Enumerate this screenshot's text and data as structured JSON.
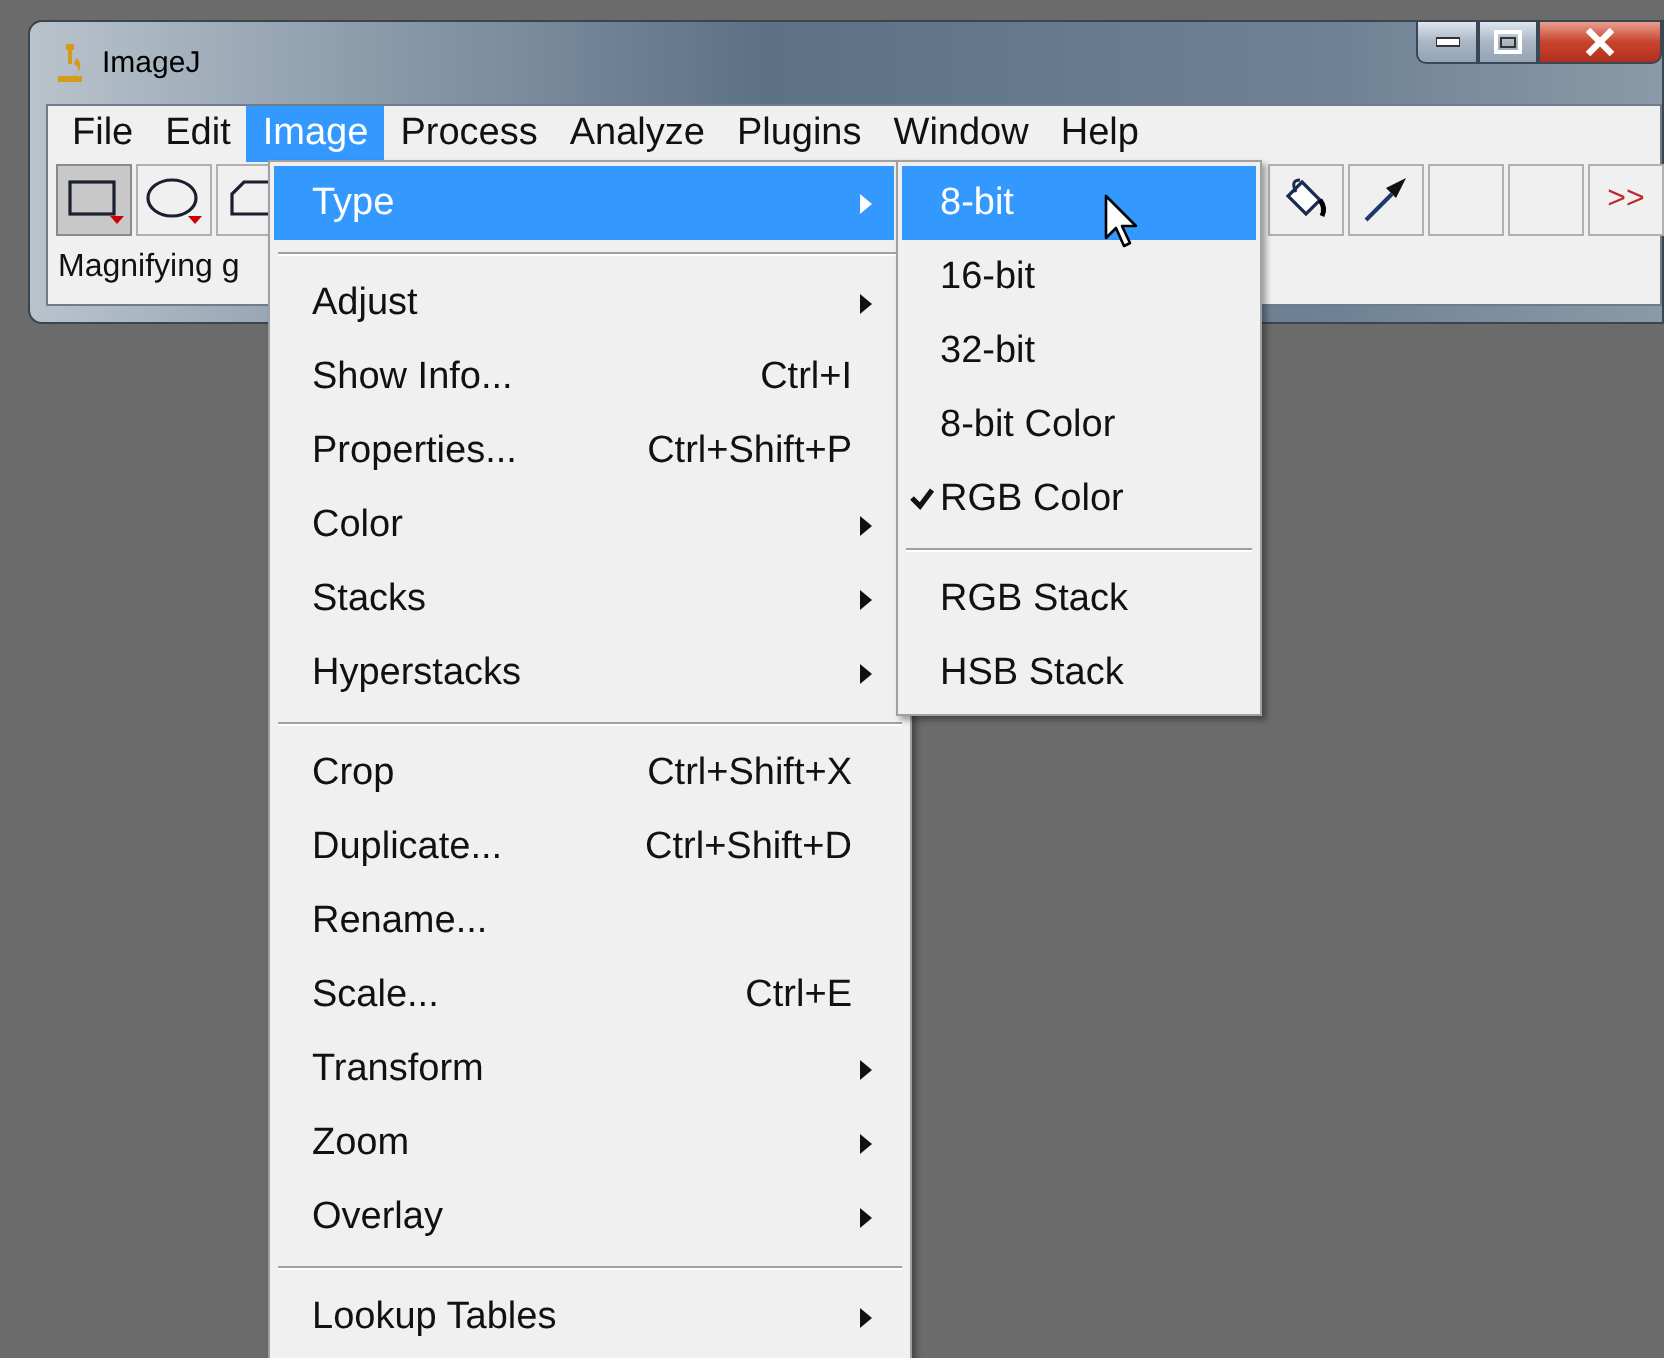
{
  "window": {
    "title": "ImageJ"
  },
  "menu_bar": [
    {
      "label": "File",
      "selected": false
    },
    {
      "label": "Edit",
      "selected": false
    },
    {
      "label": "Image",
      "selected": true
    },
    {
      "label": "Process",
      "selected": false
    },
    {
      "label": "Analyze",
      "selected": false
    },
    {
      "label": "Plugins",
      "selected": false
    },
    {
      "label": "Window",
      "selected": false
    },
    {
      "label": "Help",
      "selected": false
    }
  ],
  "toolbar_left": [
    {
      "kind": "rectangle",
      "selected": true
    },
    {
      "kind": "oval",
      "selected": false
    },
    {
      "kind": "polygon",
      "selected": false
    }
  ],
  "toolbar_right": [
    {
      "kind": "fill",
      "selected": false
    },
    {
      "kind": "dropper",
      "selected": false
    },
    {
      "kind": "blank",
      "selected": false
    },
    {
      "kind": "blank",
      "selected": false
    },
    {
      "kind": "more",
      "label": ">>",
      "selected": false
    }
  ],
  "status": "Magnifying g",
  "image_menu": [
    {
      "kind": "item",
      "label": "Type",
      "has_submenu": true,
      "selected": true
    },
    {
      "kind": "separator"
    },
    {
      "kind": "item",
      "label": "Adjust",
      "has_submenu": true,
      "selected": false
    },
    {
      "kind": "item",
      "label": "Show Info...",
      "shortcut": "Ctrl+I",
      "has_submenu": false,
      "selected": false
    },
    {
      "kind": "item",
      "label": "Properties...",
      "shortcut": "Ctrl+Shift+P",
      "has_submenu": false,
      "selected": false
    },
    {
      "kind": "item",
      "label": "Color",
      "has_submenu": true,
      "selected": false
    },
    {
      "kind": "item",
      "label": "Stacks",
      "has_submenu": true,
      "selected": false
    },
    {
      "kind": "item",
      "label": "Hyperstacks",
      "has_submenu": true,
      "selected": false
    },
    {
      "kind": "separator"
    },
    {
      "kind": "item",
      "label": "Crop",
      "shortcut": "Ctrl+Shift+X",
      "has_submenu": false,
      "selected": false
    },
    {
      "kind": "item",
      "label": "Duplicate...",
      "shortcut": "Ctrl+Shift+D",
      "has_submenu": false,
      "selected": false
    },
    {
      "kind": "item",
      "label": "Rename...",
      "has_submenu": false,
      "selected": false
    },
    {
      "kind": "item",
      "label": "Scale...",
      "shortcut": "Ctrl+E",
      "has_submenu": false,
      "selected": false
    },
    {
      "kind": "item",
      "label": "Transform",
      "has_submenu": true,
      "selected": false
    },
    {
      "kind": "item",
      "label": "Zoom",
      "has_submenu": true,
      "selected": false
    },
    {
      "kind": "item",
      "label": "Overlay",
      "has_submenu": true,
      "selected": false
    },
    {
      "kind": "separator"
    },
    {
      "kind": "item",
      "label": "Lookup Tables",
      "has_submenu": true,
      "selected": false
    }
  ],
  "type_submenu": [
    {
      "kind": "item",
      "label": "8-bit",
      "checked": false,
      "selected": true
    },
    {
      "kind": "item",
      "label": "16-bit",
      "checked": false,
      "selected": false
    },
    {
      "kind": "item",
      "label": "32-bit",
      "checked": false,
      "selected": false
    },
    {
      "kind": "item",
      "label": "8-bit Color",
      "checked": false,
      "selected": false
    },
    {
      "kind": "item",
      "label": "RGB Color",
      "checked": true,
      "selected": false
    },
    {
      "kind": "separator"
    },
    {
      "kind": "item",
      "label": "RGB Stack",
      "checked": false,
      "selected": false
    },
    {
      "kind": "item",
      "label": "HSB Stack",
      "checked": false,
      "selected": false
    }
  ]
}
